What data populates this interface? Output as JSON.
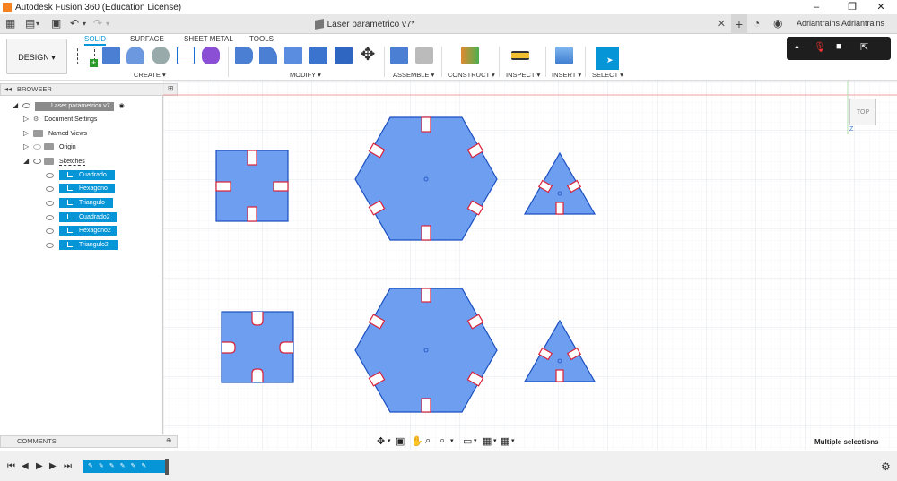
{
  "window": {
    "title": "Autodesk Fusion 360 (Education License)",
    "minimize": "–",
    "maximize": "❐",
    "close": "✕"
  },
  "doc_tab": {
    "name": "Laser parametrico v7*",
    "close": "✕"
  },
  "user": {
    "name": "Adriantrains Adriantrains"
  },
  "toolbar": {
    "workspace": "DESIGN ▾",
    "tabs": [
      "SOLID",
      "SURFACE",
      "SHEET METAL",
      "TOOLS"
    ],
    "groups": [
      "CREATE ▾",
      "MODIFY ▾",
      "ASSEMBLE ▾",
      "CONSTRUCT ▾",
      "INSPECT ▾",
      "INSERT ▾",
      "SELECT ▾"
    ]
  },
  "browser": {
    "header": "BROWSER",
    "root": "Laser parametrico v7",
    "items": [
      {
        "label": "Document Settings",
        "icon": "gear-icon"
      },
      {
        "label": "Named Views",
        "icon": "folder-icon"
      },
      {
        "label": "Origin",
        "icon": "folder-icon"
      },
      {
        "label": "Sketches",
        "icon": "folder-icon"
      }
    ],
    "sketches": [
      "Cuadrado",
      "Hexagono",
      "Triangulo",
      "Cuadrado2",
      "Hexagono2",
      "Triangulo2"
    ]
  },
  "viewcube": {
    "label": "TOP"
  },
  "comments": {
    "header": "COMMENTS"
  },
  "status": {
    "text": "Multiple selections"
  },
  "colors": {
    "accent": "#0696d7",
    "sketch_fill": "#6e9ef0",
    "sketch_stroke": "#1a4fbf",
    "slot_edge": "#d9223a"
  }
}
